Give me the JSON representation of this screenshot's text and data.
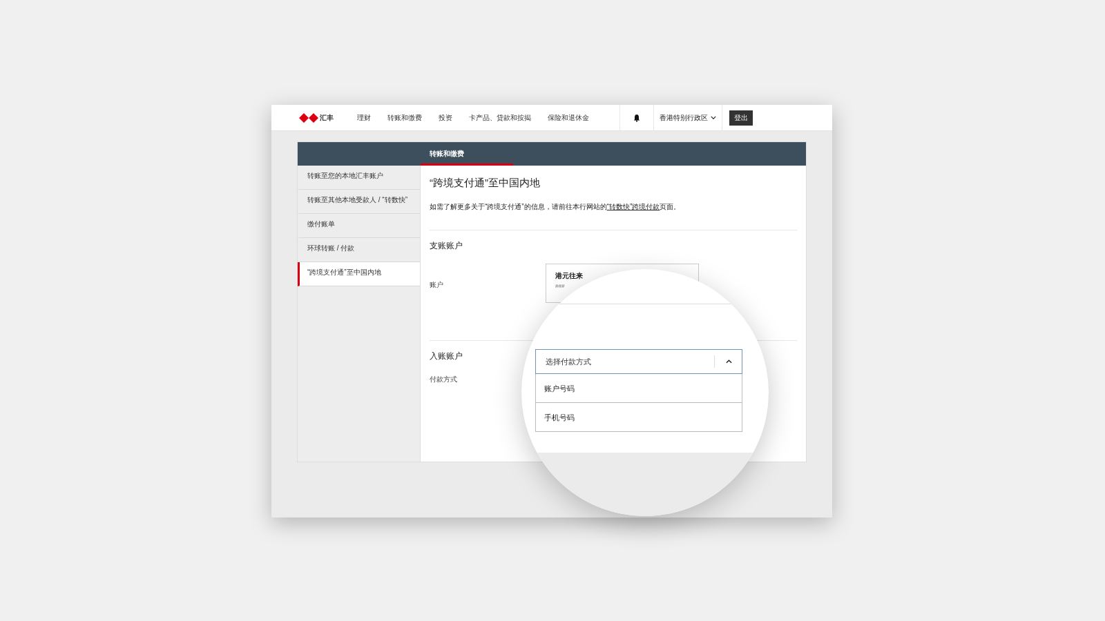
{
  "nav": {
    "logo_text": "汇丰",
    "items": [
      {
        "label": "理财"
      },
      {
        "label": "转账和缴费"
      },
      {
        "label": "投资"
      },
      {
        "label": "卡产品、贷款和按揭"
      },
      {
        "label": "保险和退休金"
      }
    ],
    "region": "香港特别行政区",
    "logout": "登出"
  },
  "section_bar": {
    "tabs": [
      {
        "label": "转账和缴费",
        "selected": true
      }
    ]
  },
  "sidebar": {
    "items": [
      {
        "label": "转账至您的本地汇丰账户",
        "selected": false
      },
      {
        "label": "转账至其他本地受款人 / “转数快”",
        "selected": false
      },
      {
        "label": "缴付账单",
        "selected": false
      },
      {
        "label": "环球转账 / 付款",
        "selected": false
      },
      {
        "label": "“跨境支付通”至中国内地",
        "selected": true
      }
    ]
  },
  "content": {
    "title": "“跨境支付通”至中国内地",
    "intro": "如需了解更多关于“跨境支付通”的信息，请前往本行网站的",
    "intro_link": "“转数快”跨境付款",
    "intro_end": "页面。",
    "debit": {
      "heading": "支账账户",
      "field_label": "账户",
      "account": {
        "name": "港元往来",
        "number": "###"
      }
    },
    "credit": {
      "heading": "入账账户",
      "field_label": "付款方式"
    }
  },
  "magnifier": {
    "dropdown": {
      "placeholder": "选择付款方式",
      "expanded": true,
      "options": [
        {
          "label": "账户号码",
          "selected": false
        },
        {
          "label": "手机号码",
          "selected": false
        }
      ]
    }
  }
}
